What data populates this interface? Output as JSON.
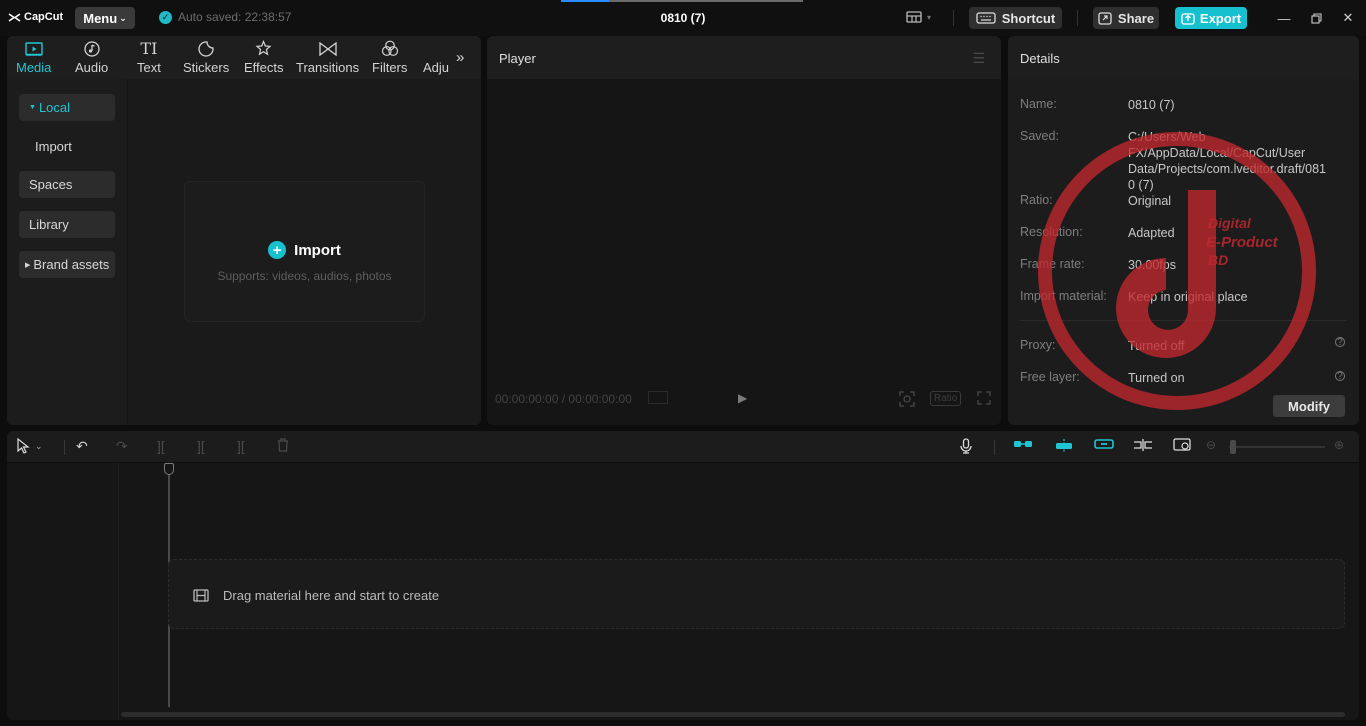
{
  "titlebar": {
    "logo": "CapCut",
    "menu_label": "Menu",
    "autosave": "Auto saved: 22:38:57",
    "project_title": "0810 (7)",
    "shortcut_label": "Shortcut",
    "share_label": "Share",
    "export_label": "Export",
    "progress": 0.2
  },
  "media": {
    "tabs": [
      {
        "label": "Media",
        "icon": "media-icon"
      },
      {
        "label": "Audio",
        "icon": "audio-icon"
      },
      {
        "label": "Text",
        "icon": "text-icon"
      },
      {
        "label": "Stickers",
        "icon": "stickers-icon"
      },
      {
        "label": "Effects",
        "icon": "effects-icon"
      },
      {
        "label": "Transitions",
        "icon": "transitions-icon"
      },
      {
        "label": "Filters",
        "icon": "filters-icon"
      },
      {
        "label": "Adju",
        "icon": "adjust-icon"
      }
    ],
    "sidebar": [
      {
        "label": "Local"
      },
      {
        "label": "Import"
      },
      {
        "label": "Spaces"
      },
      {
        "label": "Library"
      },
      {
        "label": "Brand assets"
      }
    ],
    "import_label": "Import",
    "import_hint": "Supports: videos, audios, photos"
  },
  "player": {
    "title": "Player",
    "timecode": "00:00:00:00 / 00:00:00:00",
    "ratio_label": "Ratio"
  },
  "details": {
    "title": "Details",
    "rows": [
      {
        "key": "Name:",
        "value": "0810 (7)"
      },
      {
        "key": "Saved:",
        "value": "C:/Users/Web FX/AppData/Local/CapCut/User Data/Projects/com.lveditor.draft/0810 (7)"
      },
      {
        "key": "Ratio:",
        "value": "Original"
      },
      {
        "key": "Resolution:",
        "value": "Adapted"
      },
      {
        "key": "Frame rate:",
        "value": "30.00fps"
      },
      {
        "key": "Import material:",
        "value": "Keep in original place"
      },
      {
        "key": "Proxy:",
        "value": "Turned off"
      },
      {
        "key": "Free layer:",
        "value": "Turned on"
      }
    ],
    "modify_label": "Modify"
  },
  "watermark": {
    "line1": "Digital",
    "line2": "E-Product",
    "line3": "BD"
  },
  "timeline": {
    "drop_label": "Drag material here and start to create"
  },
  "colors": {
    "accent": "#20c5d4",
    "export": "#16c0cf",
    "background": "#0d0d0d",
    "panel": "#1c1c1c",
    "watermark": "#c0282e"
  }
}
